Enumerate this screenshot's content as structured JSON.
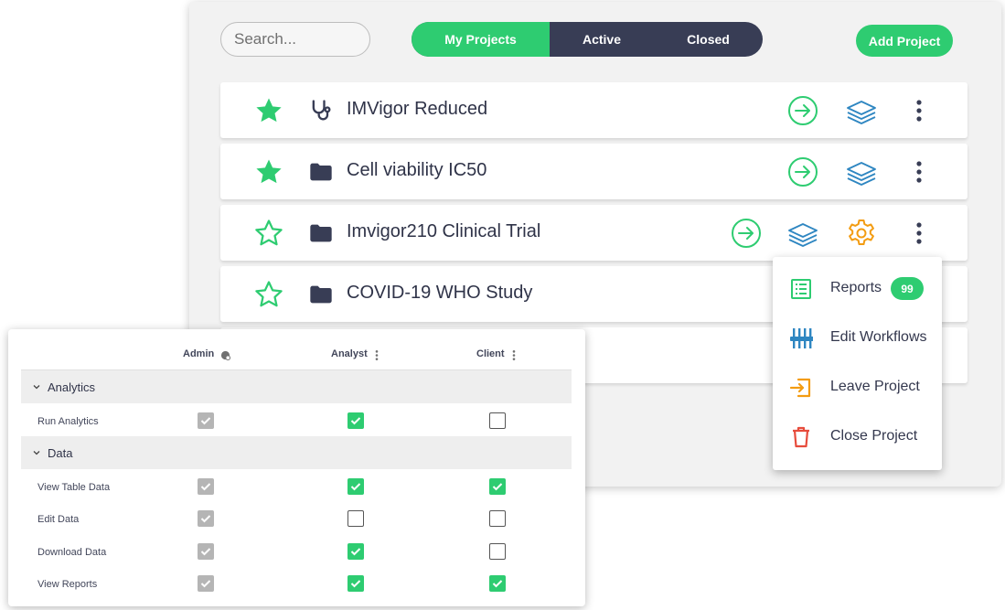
{
  "search": {
    "placeholder": "Search..."
  },
  "tabs": [
    {
      "label": "My Projects",
      "active": true
    },
    {
      "label": "Active",
      "active": false
    },
    {
      "label": "Closed",
      "active": false
    }
  ],
  "add_project_label": "Add Project",
  "projects": [
    {
      "title": "IMVigor Reduced",
      "starred": true,
      "type_icon": "stethoscope-icon"
    },
    {
      "title": "Cell viability IC50",
      "starred": true,
      "type_icon": "folder-icon"
    },
    {
      "title": "Imvigor210 Clinical Trial",
      "starred": false,
      "type_icon": "folder-icon"
    },
    {
      "title": "COVID-19 WHO Study",
      "starred": false,
      "type_icon": "folder-icon"
    }
  ],
  "menu": {
    "items": [
      {
        "label": "Reports",
        "icon": "report-list-icon",
        "badge": "99"
      },
      {
        "label": "Edit Workflows",
        "icon": "workflow-sliders-icon"
      },
      {
        "label": "Leave Project",
        "icon": "leave-project-icon"
      },
      {
        "label": "Close Project",
        "icon": "trash-icon"
      }
    ]
  },
  "permissions": {
    "columns": [
      "Admin",
      "Analyst",
      "Client"
    ],
    "groups": [
      {
        "name": "Analytics",
        "rows": [
          {
            "label": "Run Analytics",
            "values": [
              "locked",
              "checked",
              "unchecked"
            ]
          }
        ]
      },
      {
        "name": "Data",
        "rows": [
          {
            "label": "View Table Data",
            "values": [
              "locked",
              "checked",
              "checked"
            ]
          },
          {
            "label": "Edit Data",
            "values": [
              "locked",
              "unchecked",
              "unchecked"
            ]
          },
          {
            "label": "Download Data",
            "values": [
              "locked",
              "checked",
              "unchecked"
            ]
          },
          {
            "label": "View Reports",
            "values": [
              "locked",
              "checked",
              "checked"
            ]
          }
        ]
      }
    ]
  },
  "colors": {
    "accent_green": "#2ecc71",
    "navy": "#383d55",
    "blue_icon": "#2e86c1",
    "orange_icon": "#f39c12",
    "red_icon": "#e74c3c"
  }
}
